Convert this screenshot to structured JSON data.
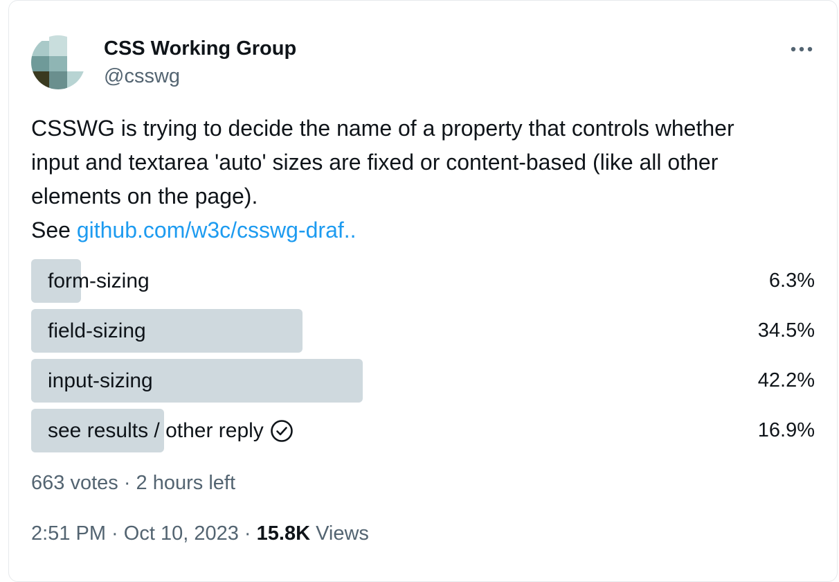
{
  "author": {
    "name": "CSS Working Group",
    "handle": "@csswg"
  },
  "tweet": {
    "text_line1": "CSSWG is trying to decide the name of a property that controls whether",
    "text_line2": "input and textarea 'auto' sizes are fixed or content-based (like all other",
    "text_line3": "elements on the page).",
    "see_prefix": "See",
    "link_text": "github.com/w3c/csswg-draf.."
  },
  "poll": {
    "options": [
      {
        "label": "form-sizing",
        "percent": "6.3%",
        "fraction": 0.063
      },
      {
        "label": "field-sizing",
        "percent": "34.5%",
        "fraction": 0.345
      },
      {
        "label": "input-sizing",
        "percent": "42.2%",
        "fraction": 0.422
      },
      {
        "label": "see results / other reply",
        "percent": "16.9%",
        "fraction": 0.169,
        "selected": true
      }
    ],
    "votes": "663 votes",
    "separator": " · ",
    "time_left": "2 hours left"
  },
  "meta": {
    "time": "2:51 PM",
    "date": "Oct 10, 2023",
    "separator": " · ",
    "views_count": "15.8K",
    "views_label": "Views"
  },
  "icons": {
    "more": "ellipsis-icon",
    "selected": "check-circle-icon"
  },
  "colors": {
    "text": "#0f1419",
    "secondary": "#536471",
    "link": "#1d9bf0",
    "poll_bar": "#cfd9de",
    "border": "#e6e9ec"
  }
}
